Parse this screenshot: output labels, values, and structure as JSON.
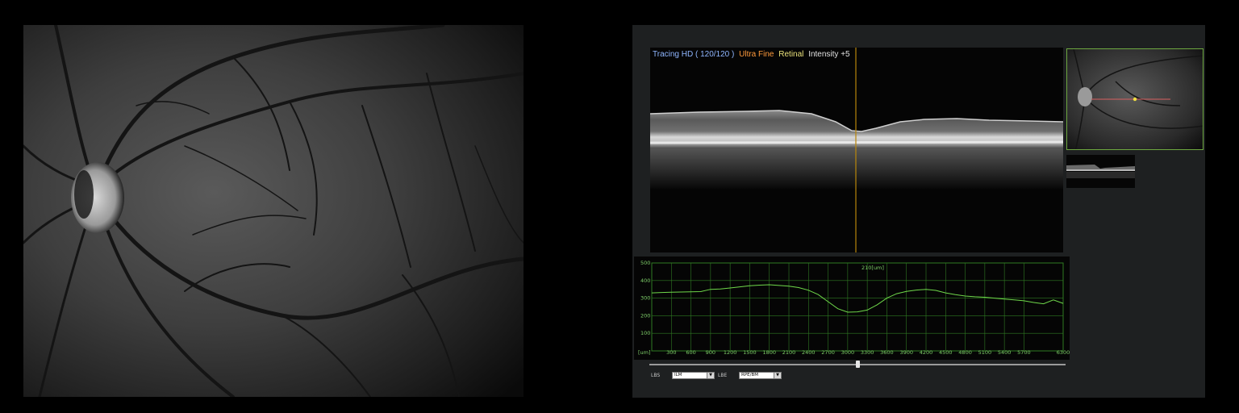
{
  "colors": {
    "background": "#000000",
    "panel": "#1e2021",
    "tracing_hd": "#8fb6ff",
    "ultra_fine": "#ff9a3c",
    "retinal": "#e9e07a",
    "intensity": "#e0e0e0",
    "graph_line": "#6fd84a",
    "graph_grid": "#2f7a22",
    "scan_marker": "#b8860b"
  },
  "scan_header": {
    "mode": "Tracing HD ( 120/120 )",
    "quality": "Ultra Fine",
    "target": "Retinal",
    "intensity": "Intensity +5"
  },
  "fundus_image": {
    "icon": "fundus-photo-icon"
  },
  "thickness_graph": {
    "label": "210[um]",
    "x_unit": "[um]",
    "y_ticks": [
      "500",
      "400",
      "300",
      "200",
      "100"
    ],
    "x_ticks": [
      "300",
      "600",
      "900",
      "1200",
      "1500",
      "1800",
      "2100",
      "2400",
      "2700",
      "3000",
      "3300",
      "3600",
      "3900",
      "4200",
      "4500",
      "4800",
      "5100",
      "5400",
      "5700",
      "6300"
    ]
  },
  "chart_data": {
    "type": "line",
    "xlabel": "[um]",
    "ylabel": "",
    "xlim": [
      0,
      6300
    ],
    "ylim": [
      0,
      500
    ],
    "grid": true,
    "annotation": "210[um]",
    "x": [
      0,
      150,
      300,
      450,
      600,
      750,
      900,
      1050,
      1200,
      1350,
      1500,
      1650,
      1800,
      1950,
      2100,
      2250,
      2400,
      2550,
      2700,
      2850,
      3000,
      3150,
      3300,
      3450,
      3600,
      3750,
      3900,
      4050,
      4200,
      4350,
      4500,
      4650,
      4800,
      4950,
      5100,
      5250,
      5400,
      5550,
      5700,
      5850,
      6000,
      6150,
      6300
    ],
    "values": [
      330,
      332,
      334,
      335,
      336,
      337,
      350,
      352,
      358,
      364,
      370,
      374,
      376,
      372,
      368,
      360,
      345,
      320,
      280,
      240,
      220,
      222,
      232,
      262,
      300,
      325,
      338,
      346,
      350,
      344,
      330,
      320,
      312,
      308,
      305,
      300,
      295,
      290,
      285,
      275,
      268,
      290,
      270
    ]
  },
  "controls": {
    "slider_position": 0.5,
    "lbs_label": "LBS",
    "lbs_value": "ILM",
    "lbe_label": "LBE",
    "lbe_value": "RPE/BM",
    "dropdown_icon": "chevron-down-icon"
  }
}
